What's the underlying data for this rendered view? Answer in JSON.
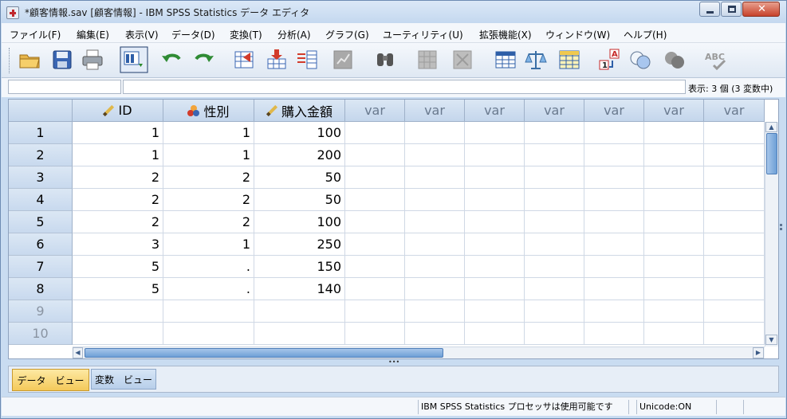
{
  "window": {
    "title": "*顧客情報.sav [顧客情報] - IBM SPSS Statistics データ エディタ",
    "min_glyph": "—",
    "max_glyph": "□",
    "close_glyph": "✕"
  },
  "menu": [
    "ファイル(F)",
    "編集(E)",
    "表示(V)",
    "データ(D)",
    "変換(T)",
    "分析(A)",
    "グラフ(G)",
    "ユーティリティ(U)",
    "拡張機能(X)",
    "ウィンドウ(W)",
    "ヘルプ(H)"
  ],
  "toolbar_icons": [
    "open-folder-icon",
    "save-icon",
    "print-icon",
    "dialog-recall-icon",
    "undo-icon",
    "redo-icon",
    "go-to-case-icon",
    "go-to-variable-icon",
    "variables-icon",
    "run-descriptives-icon",
    "find-icon",
    "insert-cases-icon",
    "insert-variable-icon",
    "split-file-icon",
    "weight-cases-icon",
    "select-cases-icon",
    "value-labels-icon",
    "use-sets-icon",
    "show-all-variables-icon",
    "spell-check-icon"
  ],
  "info": {
    "cell_ref": "",
    "cell_value": "",
    "var_count": "表示: 3 個 (3 変数中)"
  },
  "columns": [
    {
      "name": "ID",
      "icon": "scale-pencil-icon"
    },
    {
      "name": "性別",
      "icon": "nominal-circles-icon"
    },
    {
      "name": "購入金額",
      "icon": "scale-pencil-icon"
    },
    {
      "name": "var"
    },
    {
      "name": "var"
    },
    {
      "name": "var"
    },
    {
      "name": "var"
    },
    {
      "name": "var"
    },
    {
      "name": "var"
    },
    {
      "name": "var"
    }
  ],
  "rows": [
    {
      "num": "1",
      "cells": [
        "1",
        "1",
        "100"
      ]
    },
    {
      "num": "2",
      "cells": [
        "1",
        "1",
        "200"
      ]
    },
    {
      "num": "3",
      "cells": [
        "2",
        "2",
        "50"
      ]
    },
    {
      "num": "4",
      "cells": [
        "2",
        "2",
        "50"
      ]
    },
    {
      "num": "5",
      "cells": [
        "2",
        "2",
        "100"
      ]
    },
    {
      "num": "6",
      "cells": [
        "3",
        "1",
        "250"
      ]
    },
    {
      "num": "7",
      "cells": [
        "5",
        ".",
        "150"
      ]
    },
    {
      "num": "8",
      "cells": [
        "5",
        ".",
        "140"
      ]
    },
    {
      "num": "9",
      "cells": [
        "",
        "",
        ""
      ]
    },
    {
      "num": "10",
      "cells": [
        "",
        "",
        ""
      ]
    }
  ],
  "tabs": {
    "data_view": "データ　ビュー",
    "variable_view": "変数　ビュー"
  },
  "status": {
    "processor": "IBM SPSS Statistics プロセッサは使用可能です",
    "unicode": "Unicode:ON"
  },
  "colors": {
    "active_tab": "#f4c95a",
    "scroll_thumb": "#6d9fd6",
    "header_blue": "#c4d6ec"
  }
}
